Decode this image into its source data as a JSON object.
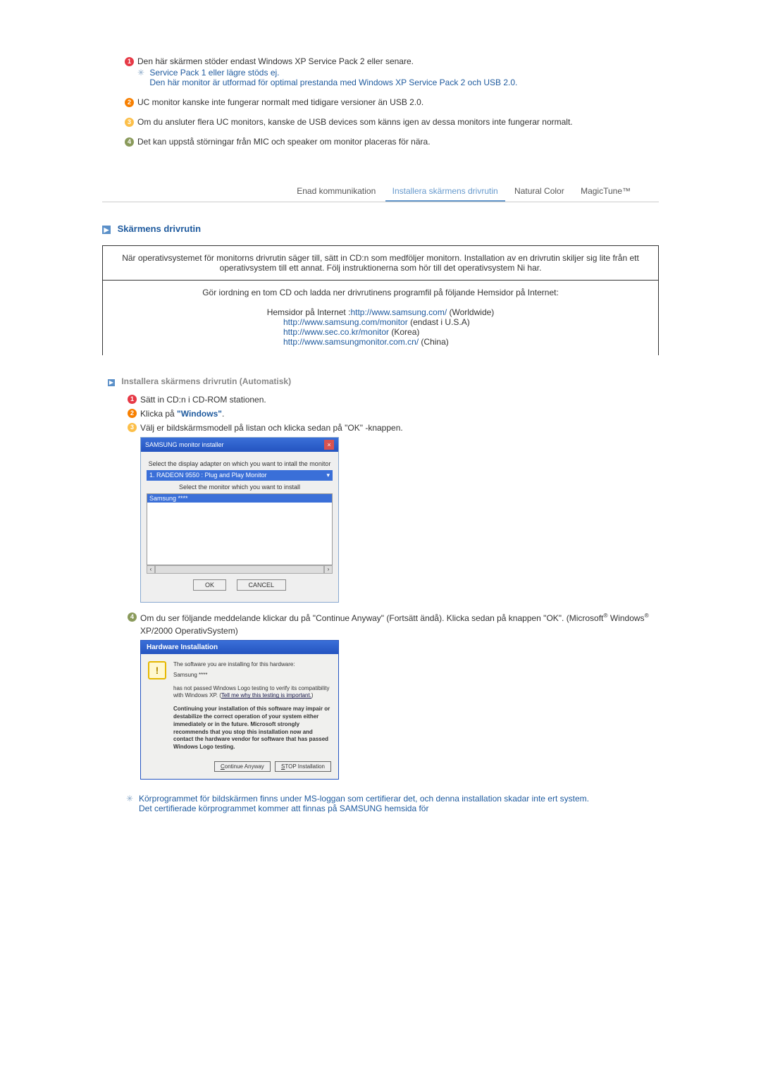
{
  "notes": {
    "n1": {
      "main": "Den här skärmen stöder endast Windows XP Service Pack 2 eller senare.",
      "sub1": "Service Pack 1 eller lägre stöds ej.",
      "sub2": "Den här monitor är utformad för optimal prestanda med Windows XP Service Pack 2 och USB 2.0."
    },
    "n2": "UC monitor kanske inte fungerar normalt med tidigare versioner än USB 2.0.",
    "n3": "Om du ansluter flera UC monitors, kanske de USB devices som känns igen av dessa monitors inte fungerar normalt.",
    "n4": "Det kan uppstå störningar från MIC och speaker om monitor placeras för nära."
  },
  "tabs": {
    "t1": "Enad kommunikation",
    "t2": "Installera skärmens drivrutin",
    "t3": "Natural Color",
    "t4": "MagicTune™"
  },
  "section_title": "Skärmens drivrutin",
  "info": {
    "p1": "När operativsystemet för monitorns drivrutin säger till, sätt in CD:n som medföljer monitorn. Installation av en drivrutin skiljer sig lite från ett operativsystem till ett annat. Följ instruktionerna som hör till det operativsystem Ni har.",
    "p2": "Gör iordning en tom CD och ladda ner drivrutinens programfil på följande Hemsidor på Internet:",
    "label": "Hemsidor på Internet :",
    "link1": "http://www.samsung.com/",
    "link1_suffix": " (Worldwide)",
    "link2": "http://www.samsung.com/monitor",
    "link2_suffix": " (endast i U.S.A)",
    "link3": "http://www.sec.co.kr/monitor",
    "link3_suffix": " (Korea)",
    "link4": "http://www.samsungmonitor.com.cn/",
    "link4_suffix": " (China)"
  },
  "subheader": "Installera skärmens drivrutin (Automatisk)",
  "steps": {
    "s1": "Sätt in CD:n i CD-ROM stationen.",
    "s2_a": "Klicka på ",
    "s2_link": "\"Windows\"",
    "s2_b": ".",
    "s3": "Välj er bildskärmsmodell på listan och klicka sedan på \"OK\" -knappen.",
    "s4_a": "Om du ser följande meddelande klickar du på \"Continue Anyway\" (Fortsätt ändå). Klicka sedan på knappen \"OK\". (Microsoft",
    "s4_b": " Windows",
    "s4_c": " XP/2000 OperativSystem)"
  },
  "installer": {
    "title": "SAMSUNG monitor installer",
    "label1": "Select the display adapter on which you want to intall the monitor",
    "select": "1. RADEON 9550 : Plug and Play Monitor",
    "label2": "Select the monitor which you want to install",
    "item": "Samsung ****",
    "ok": "OK",
    "cancel": "CANCEL"
  },
  "hw": {
    "title": "Hardware Installation",
    "line1": "The software you are installing for this hardware:",
    "line2": "Samsung ****",
    "line3a": "has not passed Windows Logo testing to verify its compatibility with Windows XP. (",
    "line3_link": "Tell me why this testing is important.",
    "line3b": ")",
    "bold": "Continuing your installation of this software may impair or destabilize the correct operation of your system either immediately or in the future. Microsoft strongly recommends that you stop this installation now and contact the hardware vendor for software that has passed Windows Logo testing.",
    "btn1_a": "C",
    "btn1_b": "ontinue Anyway",
    "btn2_a": "S",
    "btn2_b": "TOP Installation"
  },
  "footnote": {
    "p1": "Körprogrammet för bildskärmen finns under MS-loggan som certifierar det, och denna installation skadar inte ert system.",
    "p2": "Det certifierade körprogrammet kommer att finnas på SAMSUNG hemsida för"
  }
}
